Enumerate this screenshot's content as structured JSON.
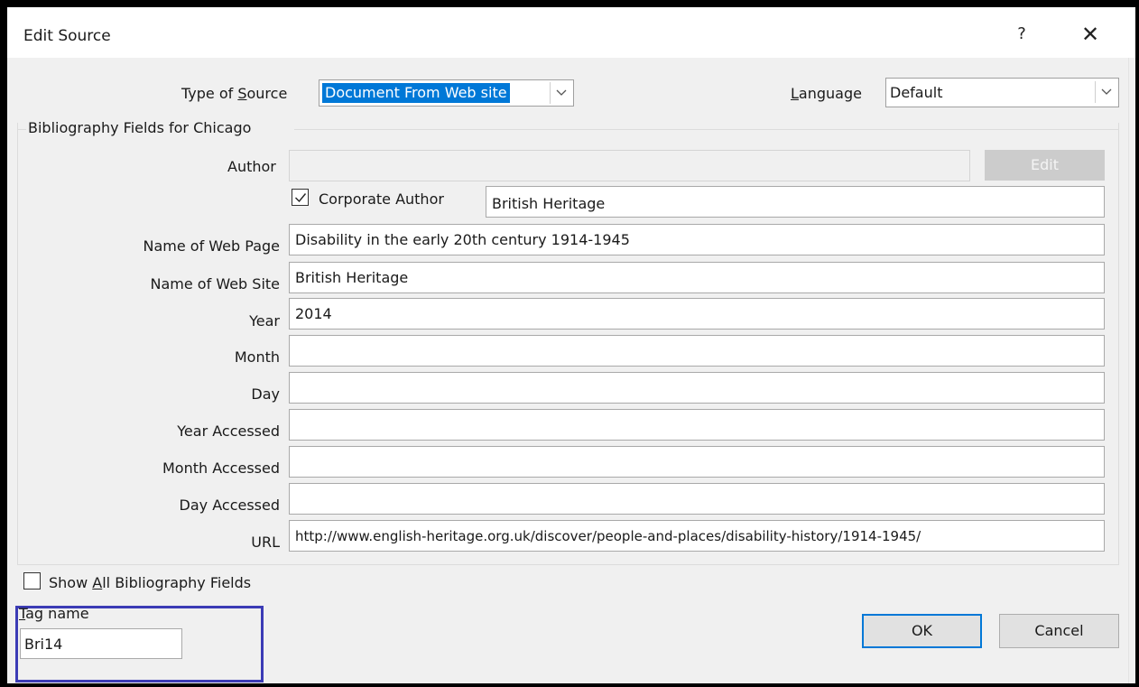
{
  "dialog": {
    "title": "Edit Source",
    "help_label": "?",
    "close_label": "✕"
  },
  "type_of_source": {
    "label_pre": "Type of ",
    "label_key": "S",
    "label_post": "ource",
    "value": "Document From Web site"
  },
  "language": {
    "label_key": "L",
    "label_post": "anguage",
    "value": "Default"
  },
  "group": {
    "title": "Bibliography Fields for Chicago"
  },
  "author": {
    "label": "Author",
    "value": "",
    "edit_label": "Edit"
  },
  "corporate_author": {
    "label": "Corporate Author",
    "checked": true,
    "value": "British Heritage"
  },
  "fields": [
    {
      "label": "Name of Web Page",
      "value": "Disability in the early 20th century 1914-1945"
    },
    {
      "label": "Name of Web Site",
      "value": "British Heritage"
    },
    {
      "label": "Year",
      "value": "2014"
    },
    {
      "label": "Month",
      "value": ""
    },
    {
      "label": "Day",
      "value": ""
    },
    {
      "label": "Year Accessed",
      "value": ""
    },
    {
      "label": "Month Accessed",
      "value": ""
    },
    {
      "label": "Day Accessed",
      "value": ""
    },
    {
      "label": "URL",
      "value": "http://www.english-heritage.org.uk/discover/people-and-places/disability-history/1914-1945/"
    }
  ],
  "show_all": {
    "label_pre": "Show ",
    "label_key": "A",
    "label_post": "ll Bibliography Fields",
    "checked": false
  },
  "tag_name": {
    "label_key": "T",
    "label_post": "ag name",
    "value": "Bri14"
  },
  "buttons": {
    "ok": "OK",
    "cancel": "Cancel"
  },
  "colors": {
    "accent": "#0078d7",
    "highlight_box": "#3b3bb5"
  }
}
